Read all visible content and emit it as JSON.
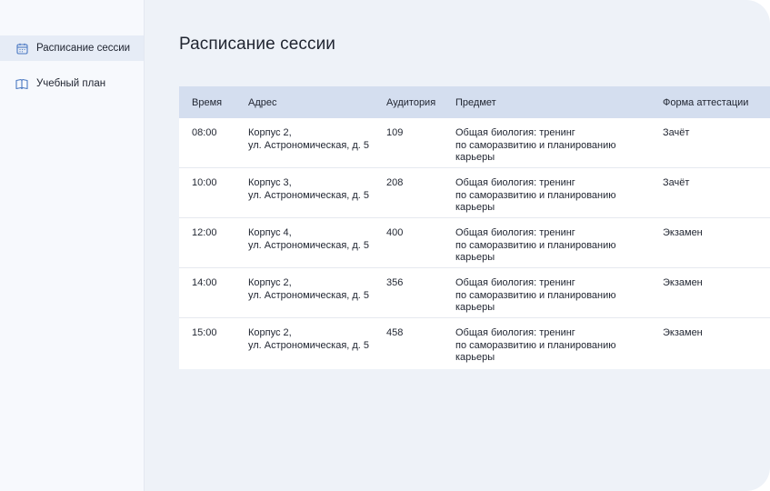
{
  "sidebar": {
    "items": [
      {
        "label": "Расписание сессии",
        "icon": "calendar-icon",
        "active": true
      },
      {
        "label": "Учебный план",
        "icon": "book-icon",
        "active": false
      }
    ]
  },
  "main": {
    "title": "Расписание сессии",
    "table": {
      "headers": {
        "time": "Время",
        "address": "Адрес",
        "room": "Аудитория",
        "subject": "Предмет",
        "form": "Форма аттестации"
      },
      "rows": [
        {
          "time": "08:00",
          "address": "Корпус 2,\nул. Астрономическая, д. 5",
          "room": "109",
          "subject": "Общая биология: тренинг\nпо саморазвитию и планированию\nкарьеры",
          "form": "Зачёт"
        },
        {
          "time": "10:00",
          "address": "Корпус 3,\nул. Астрономическая, д. 5",
          "room": "208",
          "subject": "Общая биология: тренинг\nпо саморазвитию и планированию\nкарьеры",
          "form": "Зачёт"
        },
        {
          "time": "12:00",
          "address": "Корпус 4,\nул. Астрономическая, д. 5",
          "room": "400",
          "subject": "Общая биология: тренинг\nпо саморазвитию и планированию\nкарьеры",
          "form": "Экзамен"
        },
        {
          "time": "14:00",
          "address": "Корпус 2,\nул. Астрономическая, д. 5",
          "room": "356",
          "subject": "Общая биология: тренинг\nпо саморазвитию и планированию\nкарьеры",
          "form": "Экзамен"
        },
        {
          "time": "15:00",
          "address": "Корпус 2,\nул. Астрономическая, д. 5",
          "room": "458",
          "subject": "Общая биология: тренинг\nпо саморазвитию и планированию\nкарьеры",
          "form": "Экзамен"
        }
      ]
    }
  },
  "colors": {
    "accent": "#4a78c2",
    "sidebar_bg": "#f7f9fd",
    "active_item_bg": "#e6ecf6",
    "content_bg": "#eef2f8",
    "table_header_bg": "#d4deef"
  }
}
